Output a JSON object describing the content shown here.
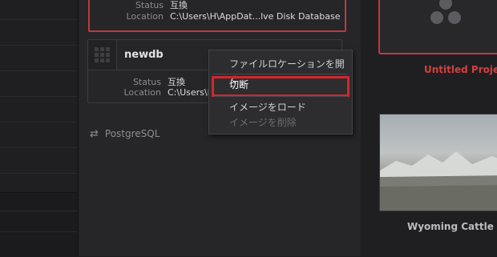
{
  "database_1": {
    "status_label": "Status",
    "status_value": "互換",
    "location_label": "Location",
    "location_value": "C:\\Users\\H\\AppDat...lve Disk Database"
  },
  "database_2": {
    "name": "newdb",
    "status_label": "Status",
    "status_value": "互換",
    "location_label": "Location",
    "location_value": "C:\\Users\\H"
  },
  "postgres_label": "PostgreSQL",
  "context_menu": {
    "items": [
      {
        "label": "ファイルロケーションを開く",
        "enabled": true
      },
      {
        "label": "切断",
        "enabled": true,
        "highlighted": true
      },
      {
        "label": "イメージをロード",
        "enabled": true
      },
      {
        "label": "イメージを削除",
        "enabled": false
      }
    ]
  },
  "projects": [
    {
      "title": "Untitled Projec",
      "selected": true
    },
    {
      "title": "Wyoming Cattle Ra",
      "selected": false
    }
  ],
  "colors": {
    "accent_red": "#c0383f",
    "highlight_red": "#d3262c"
  }
}
